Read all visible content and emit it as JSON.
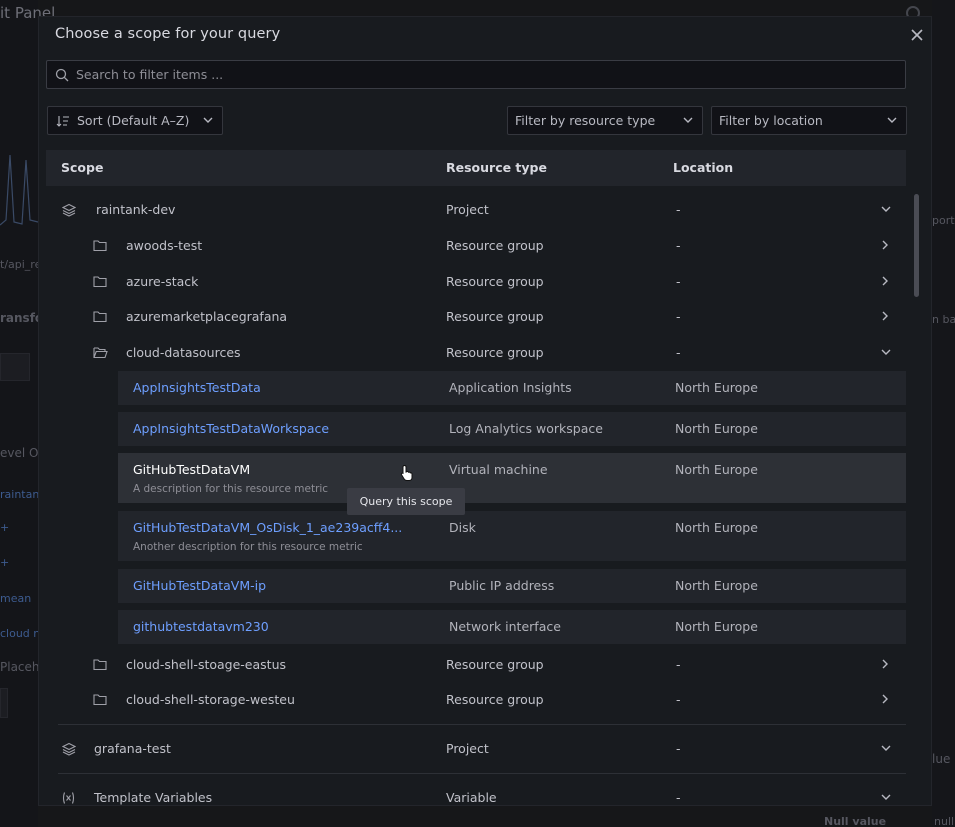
{
  "background": {
    "title": "it Panel",
    "fragments": [
      "t/api_re",
      "ransfo",
      "evel O",
      "raintank",
      "mean",
      "cloud m",
      "Placeh",
      "ports",
      "n bac",
      "lue",
      "Null value",
      "null"
    ]
  },
  "modal": {
    "title": "Choose a scope for your query",
    "close_icon": "close-icon",
    "search": {
      "placeholder": "Search to filter items ...",
      "value": ""
    },
    "sort": {
      "label": "Sort (Default A–Z)"
    },
    "filter_type": {
      "label": "Filter by resource type"
    },
    "filter_location": {
      "label": "Filter by location"
    },
    "columns": {
      "scope": "Scope",
      "type": "Resource type",
      "location": "Location"
    },
    "rows": [
      {
        "name": "raintank-dev",
        "type": "Project",
        "location": "-"
      },
      {
        "name": "awoods-test",
        "type": "Resource group",
        "location": "-"
      },
      {
        "name": "azure-stack",
        "type": "Resource group",
        "location": "-"
      },
      {
        "name": "azuremarketplacegrafana",
        "type": "Resource group",
        "location": "-"
      },
      {
        "name": "cloud-datasources",
        "type": "Resource group",
        "location": "-"
      },
      {
        "name": "cloud-shell-stoage-eastus",
        "type": "Resource group",
        "location": "-"
      },
      {
        "name": "cloud-shell-storage-westeu",
        "type": "Resource group",
        "location": "-"
      },
      {
        "name": "grafana-test",
        "type": "Project",
        "location": "-"
      },
      {
        "name": "Template Variables",
        "type": "Variable",
        "location": "-"
      }
    ],
    "resources": [
      {
        "name": "AppInsightsTestData",
        "type": "Application Insights",
        "location": "North Europe",
        "description": ""
      },
      {
        "name": "AppInsightsTestDataWorkspace",
        "type": "Log Analytics workspace",
        "location": "North Europe",
        "description": ""
      },
      {
        "name": "GitHubTestDataVM",
        "type": "Virtual machine",
        "location": "North Europe",
        "description": "A description for this resource metric"
      },
      {
        "name": "GitHubTestDataVM_OsDisk_1_ae239acff4...",
        "type": "Disk",
        "location": "North Europe",
        "description": "Another description for this resource metric"
      },
      {
        "name": "GitHubTestDataVM-ip",
        "type": "Public IP address",
        "location": "North Europe",
        "description": ""
      },
      {
        "name": "githubtestdatavm230",
        "type": "Network interface",
        "location": "North Europe",
        "description": ""
      }
    ],
    "tooltip": "Query this scope"
  },
  "colors": {
    "link": "#6e9fff",
    "modal_bg": "#181b1f",
    "row_bg": "#22252b"
  }
}
